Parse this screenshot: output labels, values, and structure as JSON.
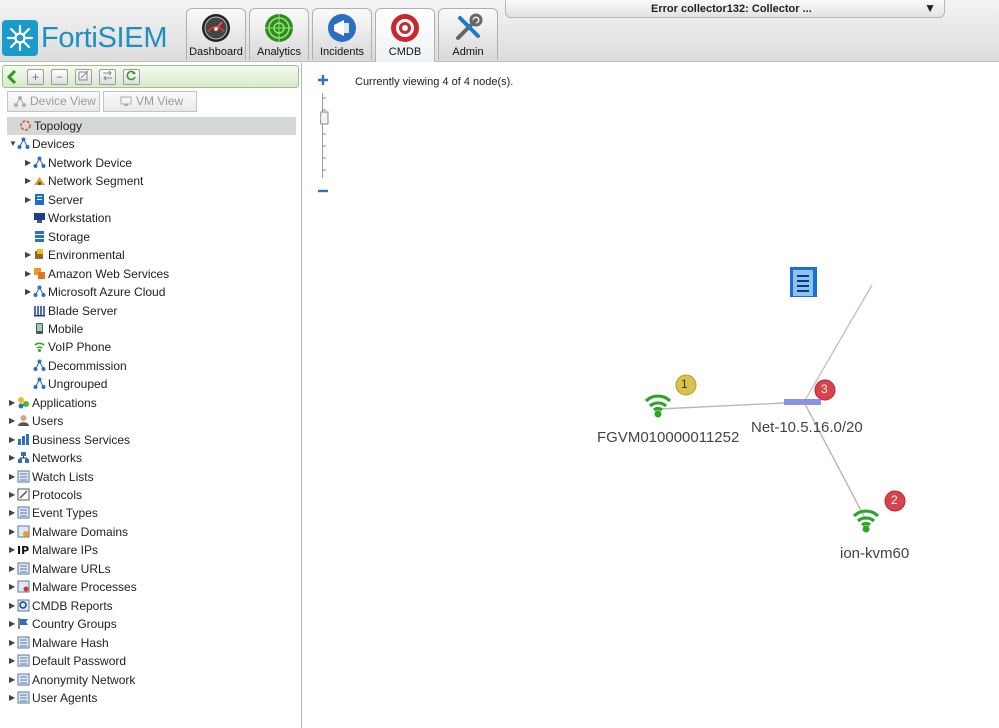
{
  "app": {
    "brand": "FortiSIEM",
    "brand_color": "#1d8fc0"
  },
  "tabs": [
    {
      "label": "Dashboard",
      "icon": "dashboard-gauge-icon"
    },
    {
      "label": "Analytics",
      "icon": "analytics-radar-icon"
    },
    {
      "label": "Incidents",
      "icon": "incidents-megaphone-icon"
    },
    {
      "label": "CMDB",
      "icon": "cmdb-target-icon",
      "active": true
    },
    {
      "label": "Admin",
      "icon": "admin-tools-icon"
    }
  ],
  "error_dropdown": {
    "text": "Error collector132: Collector ..."
  },
  "sidebar": {
    "view_buttons": {
      "device_view": "Device View",
      "vm_view": "VM View"
    },
    "tree": [
      {
        "label": "Topology",
        "level": 0,
        "selected": true
      },
      {
        "label": "Devices",
        "level": 0,
        "expanded": true
      },
      {
        "label": "Network Device",
        "level": 1,
        "toggle": true
      },
      {
        "label": "Network Segment",
        "level": 1,
        "toggle": true
      },
      {
        "label": "Server",
        "level": 1,
        "toggle": true
      },
      {
        "label": "Workstation",
        "level": 1
      },
      {
        "label": "Storage",
        "level": 1
      },
      {
        "label": "Environmental",
        "level": 1,
        "toggle": true
      },
      {
        "label": "Amazon Web Services",
        "level": 1,
        "toggle": true
      },
      {
        "label": "Microsoft Azure Cloud",
        "level": 1,
        "toggle": true
      },
      {
        "label": "Blade Server",
        "level": 1
      },
      {
        "label": "Mobile",
        "level": 1
      },
      {
        "label": "VoIP Phone",
        "level": 1
      },
      {
        "label": "Decommission",
        "level": 1
      },
      {
        "label": "Ungrouped",
        "level": 1
      },
      {
        "label": "Applications",
        "level": 0,
        "toggle": true
      },
      {
        "label": "Users",
        "level": 0,
        "toggle": true
      },
      {
        "label": "Business Services",
        "level": 0,
        "toggle": true
      },
      {
        "label": "Networks",
        "level": 0,
        "toggle": true
      },
      {
        "label": "Watch Lists",
        "level": 0,
        "toggle": true
      },
      {
        "label": "Protocols",
        "level": 0,
        "toggle": true
      },
      {
        "label": "Event Types",
        "level": 0,
        "toggle": true
      },
      {
        "label": "Malware Domains",
        "level": 0,
        "toggle": true
      },
      {
        "label": "Malware IPs",
        "level": 0,
        "toggle": true
      },
      {
        "label": "Malware URLs",
        "level": 0,
        "toggle": true
      },
      {
        "label": "Malware Processes",
        "level": 0,
        "toggle": true
      },
      {
        "label": "CMDB Reports",
        "level": 0,
        "toggle": true
      },
      {
        "label": "Country Groups",
        "level": 0,
        "toggle": true
      },
      {
        "label": "Malware Hash",
        "level": 0,
        "toggle": true
      },
      {
        "label": "Default Password",
        "level": 0,
        "toggle": true
      },
      {
        "label": "Anonymity Network",
        "level": 0,
        "toggle": true
      },
      {
        "label": "User Agents",
        "level": 0,
        "toggle": true
      }
    ]
  },
  "topology": {
    "viewing_text": "Currently viewing 4 of 4 node(s).",
    "nodes": [
      {
        "label": "FGVM010000011252",
        "badge": "1",
        "badge_color": "#d8c24a",
        "icon": "wifi-device-icon"
      },
      {
        "label": "Net-10.5.16.0/20",
        "badge": "3",
        "badge_color": "#d9434d",
        "icon": "network-segment-icon"
      },
      {
        "label": "ion-kvm60",
        "badge": "2",
        "badge_color": "#d9434d",
        "icon": "wifi-device-icon"
      },
      {
        "label": "",
        "icon": "server-icon"
      }
    ]
  }
}
